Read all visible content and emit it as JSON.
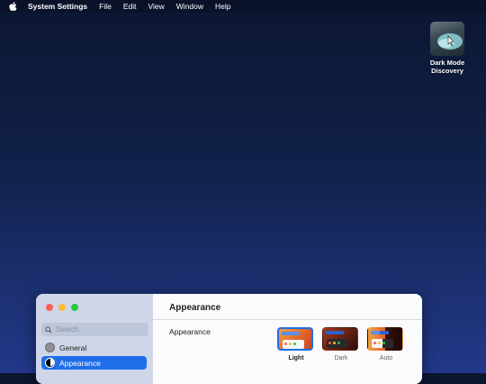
{
  "menubar": {
    "app_name": "System Settings",
    "items": [
      "File",
      "Edit",
      "View",
      "Window",
      "Help"
    ]
  },
  "desktop": {
    "icon_label_line1": "Dark Mode",
    "icon_label_line2": "Discovery"
  },
  "window": {
    "search_placeholder": "Search",
    "sidebar_items": [
      {
        "label": "General",
        "icon": "gear-icon",
        "selected": false
      },
      {
        "label": "Appearance",
        "icon": "appearance-icon",
        "selected": true
      }
    ],
    "title": "Appearance",
    "row_label": "Appearance",
    "options": [
      {
        "label": "Light",
        "selected": true
      },
      {
        "label": "Dark",
        "selected": false
      },
      {
        "label": "Auto",
        "selected": false
      }
    ]
  },
  "colors": {
    "accent": "#1f6ee8",
    "close": "#ff5f57",
    "minimize": "#febc2e",
    "zoom": "#28c840"
  }
}
